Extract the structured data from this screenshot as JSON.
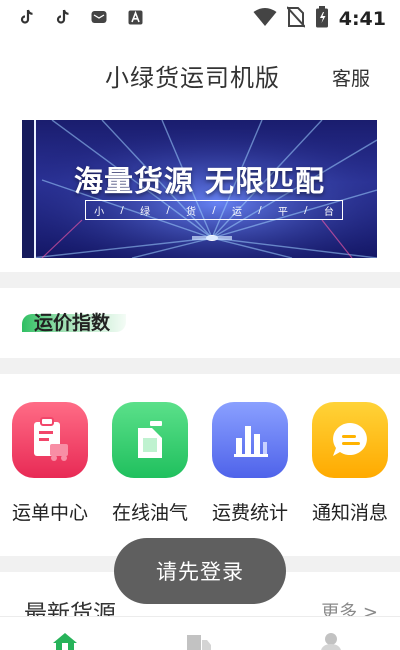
{
  "status_bar": {
    "time": "4:41",
    "left_icons": [
      "tiktok-icon",
      "tiktok-icon",
      "mail-icon",
      "font-a-icon"
    ],
    "right_icons": [
      "wifi-icon",
      "no-sim-icon",
      "battery-icon"
    ]
  },
  "header": {
    "title": "小绿货运司机版",
    "service_label": "客服"
  },
  "banner": {
    "title": "海量货源 无限匹配",
    "subtitle_chars": [
      "小",
      "/",
      "绿",
      "/",
      "货",
      "/",
      "运",
      "/",
      "平",
      "/",
      "台"
    ]
  },
  "freight_index": {
    "title": "运价指数"
  },
  "menu": {
    "items": [
      {
        "label": "运单中心",
        "icon": "waybill-icon",
        "color_top": "#ff6c86",
        "color_bottom": "#e82a55"
      },
      {
        "label": "在线油气",
        "icon": "fuel-can-icon",
        "color_top": "#5be08a",
        "color_bottom": "#20c05e"
      },
      {
        "label": "运费统计",
        "icon": "bar-chart-icon",
        "color_top": "#8aa0ff",
        "color_bottom": "#4f63ea"
      },
      {
        "label": "通知消息",
        "icon": "message-icon",
        "color_top": "#ffd338",
        "color_bottom": "#ffaa00"
      }
    ]
  },
  "latest_goods": {
    "title": "最新货源",
    "more_label": "更多 >"
  },
  "toast": {
    "text": "请先登录"
  },
  "bottom_nav": {
    "items": [
      "home-icon",
      "truck-icon",
      "user-icon"
    ],
    "active_color": "#27b35a"
  }
}
